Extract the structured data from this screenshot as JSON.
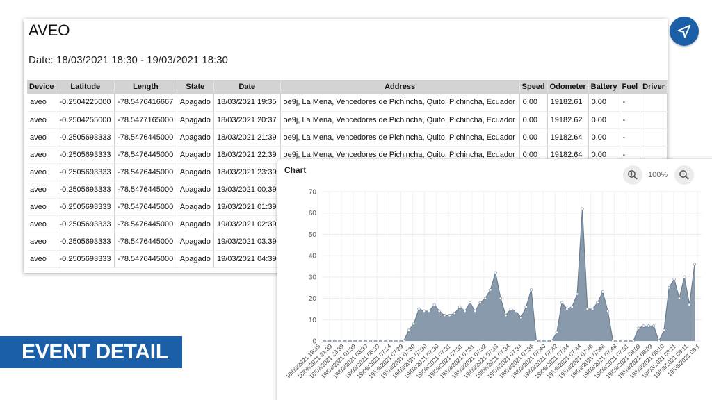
{
  "report": {
    "title": "AVEO",
    "date_range": "Date: 18/03/2021 18:30 - 19/03/2021 18:30",
    "columns": [
      "Device",
      "Latitude",
      "Length",
      "State",
      "Date",
      "Address",
      "Speed",
      "Odometer",
      "Battery",
      "Fuel",
      "Driver"
    ],
    "rows": [
      [
        "aveo",
        "-0.2504225000",
        "-78.5476416667",
        "Apagado",
        "18/03/2021 19:35",
        "oe9j, La Mena, Vencedores de Pichincha, Quito, Pichincha, Ecuador",
        "0.00",
        "19182.61",
        "0.00",
        "-",
        ""
      ],
      [
        "aveo",
        "-0.2504255000",
        "-78.5477165000",
        "Apagado",
        "18/03/2021 20:37",
        "oe9j, La Mena, Vencedores de Pichincha, Quito, Pichincha, Ecuador",
        "0.00",
        "19182.62",
        "0.00",
        "-",
        ""
      ],
      [
        "aveo",
        "-0.2505693333",
        "-78.5476445000",
        "Apagado",
        "18/03/2021 21:39",
        "oe9j, La Mena, Vencedores de Pichincha, Quito, Pichincha, Ecuador",
        "0.00",
        "19182.64",
        "0.00",
        "-",
        ""
      ],
      [
        "aveo",
        "-0.2505693333",
        "-78.5476445000",
        "Apagado",
        "18/03/2021 22:39",
        "oe9j, La Mena, Vencedores de Pichincha, Quito, Pichincha, Ecuador",
        "0.00",
        "19182.64",
        "0.00",
        "-",
        ""
      ],
      [
        "aveo",
        "-0.2505693333",
        "-78.5476445000",
        "Apagado",
        "18/03/2021 23:39",
        "",
        "",
        "",
        "",
        "",
        ""
      ],
      [
        "aveo",
        "-0.2505693333",
        "-78.5476445000",
        "Apagado",
        "19/03/2021 00:39",
        "",
        "",
        "",
        "",
        "",
        ""
      ],
      [
        "aveo",
        "-0.2505693333",
        "-78.5476445000",
        "Apagado",
        "19/03/2021 01:39",
        "",
        "",
        "",
        "",
        "",
        ""
      ],
      [
        "aveo",
        "-0.2505693333",
        "-78.5476445000",
        "Apagado",
        "19/03/2021 02:39",
        "",
        "",
        "",
        "",
        "",
        ""
      ],
      [
        "aveo",
        "-0.2505693333",
        "-78.5476445000",
        "Apagado",
        "19/03/2021 03:39",
        "",
        "",
        "",
        "",
        "",
        ""
      ],
      [
        "aveo",
        "-0.2505693333",
        "-78.5476445000",
        "Apagado",
        "19/03/2021 04:39",
        "",
        "",
        "",
        "",
        "",
        ""
      ]
    ]
  },
  "send_button": {
    "icon": "navigation-arrow-icon",
    "color": "#1a5fa8"
  },
  "banner": {
    "text": "EVENT DETAIL",
    "color": "#1a5fa8"
  },
  "chart_panel": {
    "title": "Chart",
    "zoom_level": "100%",
    "zoom_in_icon": "zoom-in-icon",
    "zoom_out_icon": "zoom-out-icon"
  },
  "chart_data": {
    "type": "area",
    "title": "Chart",
    "xlabel": "",
    "ylabel": "",
    "ylim": [
      0,
      70
    ],
    "yticks": [
      0,
      10,
      20,
      30,
      40,
      50,
      60,
      70
    ],
    "grid": true,
    "fill_color": "#8a9aad",
    "line_color": "#6c7d91",
    "x_tick_labels": [
      "18/03/2021 19:35",
      "18/03/2021 21:39",
      "18/03/2021 23:39",
      "19/03/2021 01:39",
      "19/03/2021 03:39",
      "19/03/2021 05:39",
      "19/03/2021 07:24",
      "19/03/2021 07:29",
      "19/03/2021 07:30",
      "19/03/2021 07:30",
      "19/03/2021 07:30",
      "19/03/2021 07:31",
      "19/03/2021 07:31",
      "19/03/2021 07:31",
      "19/03/2021 07:32",
      "19/03/2021 07:33",
      "19/03/2021 07:34",
      "19/03/2021 07:34",
      "19/03/2021 07:36",
      "19/03/2021 07:40",
      "19/03/2021 07:42",
      "19/03/2021 07:44",
      "19/03/2021 07:44",
      "19/03/2021 07:46",
      "19/03/2021 07:46",
      "19/03/2021 07:48",
      "19/03/2021 07:51",
      "19/03/2021 08:08",
      "19/03/2021 08:09",
      "19/03/2021 08:10",
      "19/03/2021 08:11",
      "19/03/2021 08:11",
      "19/03/2021 08:1"
    ],
    "values": [
      0,
      0,
      0,
      0,
      0,
      0,
      0,
      0,
      0,
      0,
      0,
      0,
      0,
      0,
      0,
      0,
      0,
      5,
      8,
      15,
      14,
      14,
      17,
      14,
      12,
      12,
      13,
      16,
      14,
      18,
      14,
      18,
      20,
      24,
      32,
      20,
      12,
      15,
      14,
      11,
      16,
      24,
      0,
      0,
      0,
      0,
      4,
      18,
      15,
      16,
      22,
      62,
      15,
      15,
      18,
      23,
      14,
      0,
      0,
      0,
      0,
      0,
      6,
      7,
      7,
      7,
      0,
      5,
      25,
      29,
      20,
      30,
      17,
      36
    ]
  }
}
